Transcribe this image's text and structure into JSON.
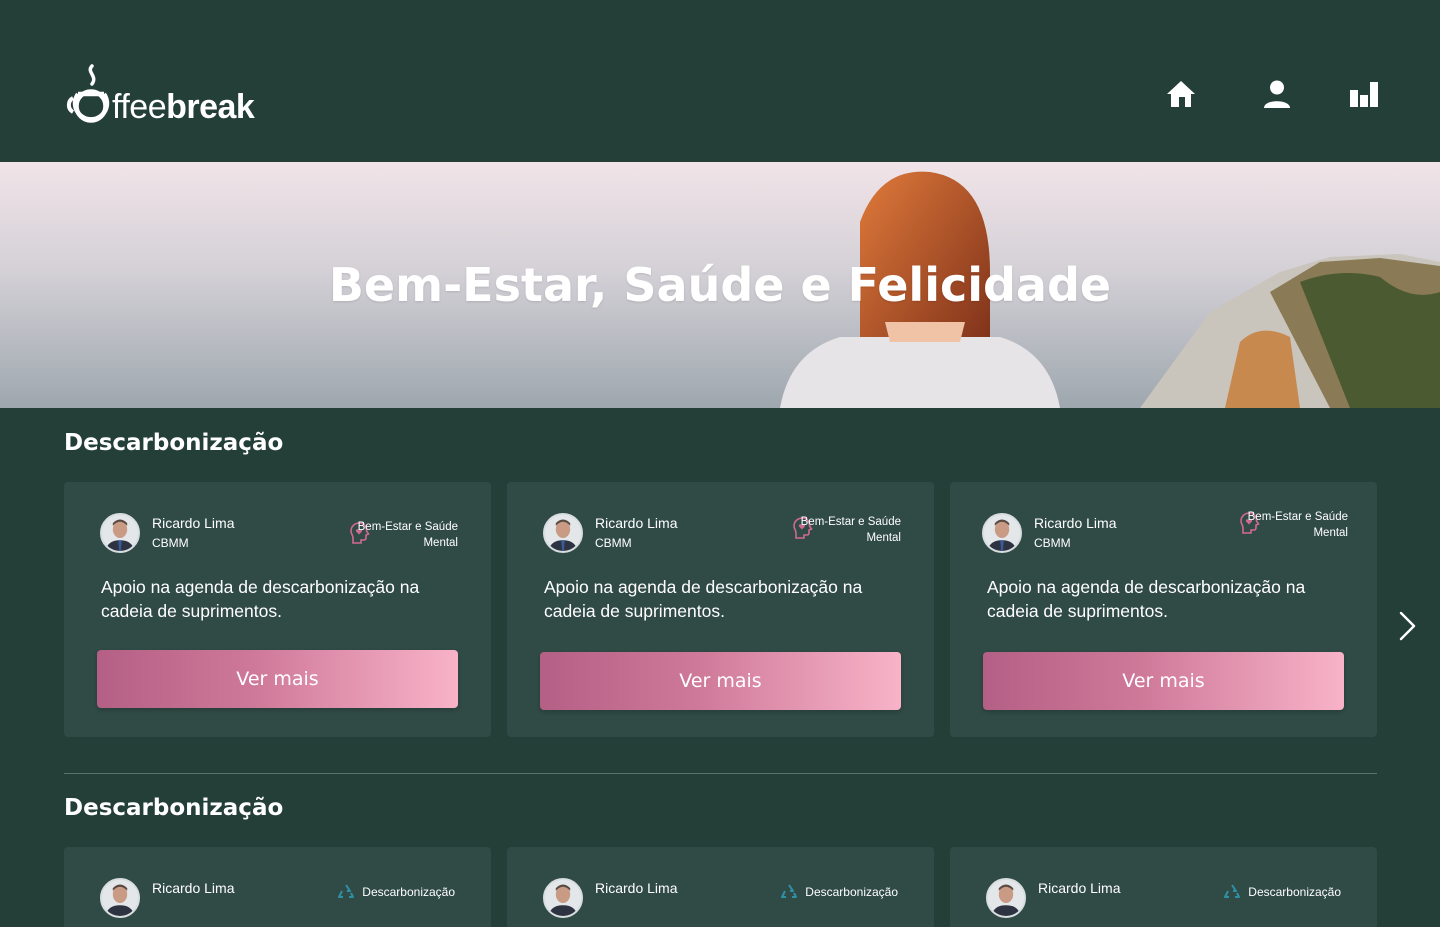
{
  "header": {
    "logo_light": "ffee",
    "logo_bold": "break",
    "nav": [
      {
        "name": "home-icon"
      },
      {
        "name": "profile-icon"
      },
      {
        "name": "stats-icon"
      }
    ]
  },
  "hero": {
    "title": "Bem-Estar, Saúde e Felicidade"
  },
  "sections": [
    {
      "title": "Descarbonização",
      "cards": [
        {
          "author": "Ricardo Lima",
          "company": "CBMM",
          "tag": "Bem-Estar e Saúde Mental",
          "tag_icon": "mental-health-icon",
          "description": "Apoio na agenda de descarbonização na cadeia de suprimentos.",
          "button": "Ver mais"
        },
        {
          "author": "Ricardo Lima",
          "company": "CBMM",
          "tag": "Bem-Estar e Saúde Mental",
          "tag_icon": "mental-health-icon",
          "description": "Apoio na agenda de descarbonização na cadeia de suprimentos.",
          "button": "Ver mais"
        },
        {
          "author": "Ricardo Lima",
          "company": "CBMM",
          "tag": "Bem-Estar e Saúde Mental",
          "tag_icon": "mental-health-icon",
          "description": "Apoio na agenda de descarbonização na cadeia de suprimentos.",
          "button": "Ver mais"
        }
      ]
    },
    {
      "title": "Descarbonização",
      "cards": [
        {
          "author": "Ricardo Lima",
          "tag": "Descarbonização",
          "tag_icon": "recycle-icon"
        },
        {
          "author": "Ricardo Lima",
          "tag": "Descarbonização",
          "tag_icon": "recycle-icon"
        },
        {
          "author": "Ricardo Lima",
          "tag": "Descarbonização",
          "tag_icon": "recycle-icon"
        }
      ]
    }
  ],
  "colors": {
    "background": "#243e38",
    "card": "#304a45",
    "button_gradient_start": "#b45f85",
    "button_gradient_end": "#f8b3c8",
    "tag_icon_pink": "#d06a8f",
    "tag_icon_teal": "#2f8fa6"
  }
}
